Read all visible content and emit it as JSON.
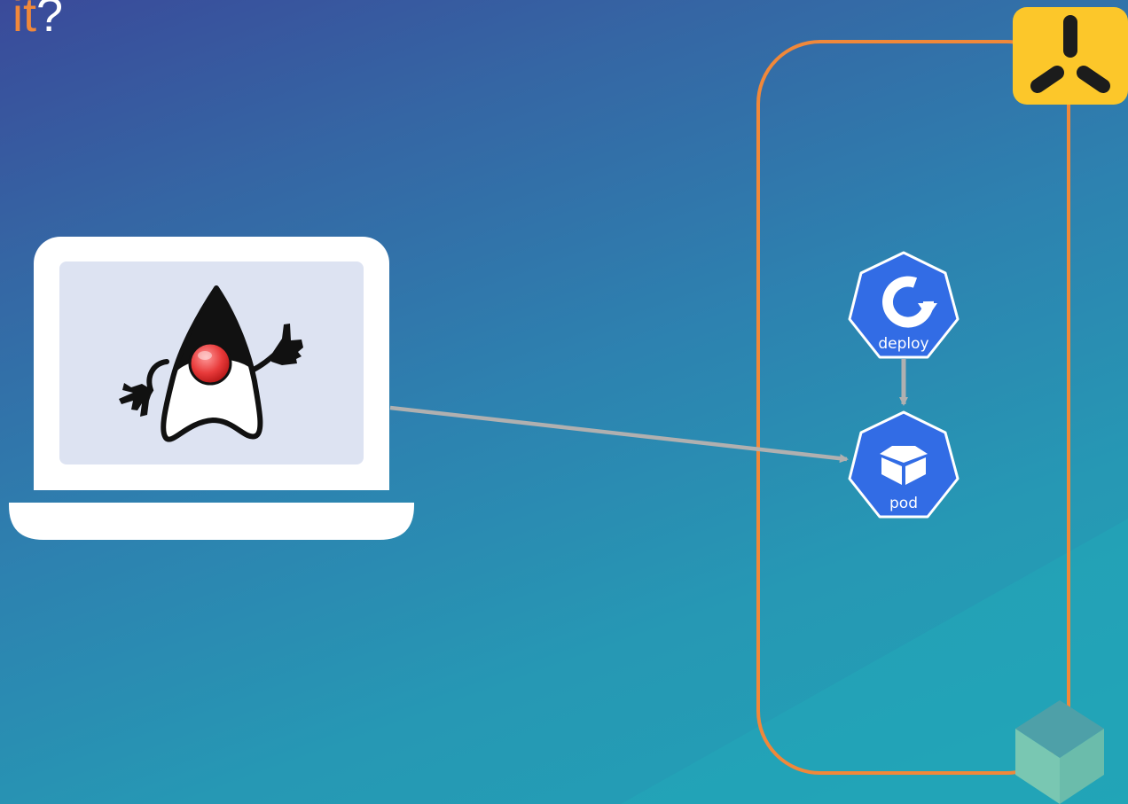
{
  "slide": {
    "title_accent": "it",
    "title_rest": "?"
  },
  "nodes": {
    "deploy": {
      "label": "deploy"
    },
    "pod": {
      "label": "pod"
    }
  },
  "colors": {
    "cluster_border": "#f0883a",
    "k8s_blue": "#326ce5",
    "accent_yellow": "#fcc72a",
    "connector": "#b0b0b0",
    "screen": "#dde3f2",
    "cube_top": "#4ea0a8",
    "cube_side": "#79c7b2"
  }
}
